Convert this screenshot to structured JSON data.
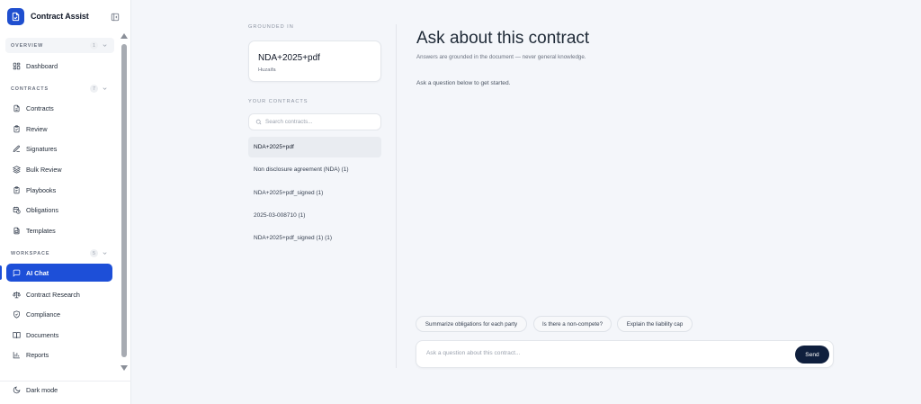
{
  "app": {
    "name": "Contract Assist"
  },
  "sidebar": {
    "sections": [
      {
        "title": "OVERVIEW",
        "count": "1",
        "items": [
          {
            "label": "Dashboard",
            "icon": "dashboard-icon"
          }
        ]
      },
      {
        "title": "CONTRACTS",
        "count": "7",
        "items": [
          {
            "label": "Contracts",
            "icon": "document-icon"
          },
          {
            "label": "Review",
            "icon": "clipboard-check-icon"
          },
          {
            "label": "Signatures",
            "icon": "pen-icon"
          },
          {
            "label": "Bulk Review",
            "icon": "layers-icon"
          },
          {
            "label": "Playbooks",
            "icon": "clipboard-icon"
          },
          {
            "label": "Obligations",
            "icon": "calendar-clock-icon"
          },
          {
            "label": "Templates",
            "icon": "file-template-icon"
          }
        ]
      },
      {
        "title": "WORKSPACE",
        "count": "5",
        "items": [
          {
            "label": "AI Chat",
            "icon": "chat-icon",
            "active": true
          },
          {
            "label": "Contract Research",
            "icon": "scale-icon"
          },
          {
            "label": "Compliance",
            "icon": "shield-check-icon"
          },
          {
            "label": "Documents",
            "icon": "book-icon"
          },
          {
            "label": "Reports",
            "icon": "bar-chart-icon"
          }
        ]
      }
    ],
    "footer": {
      "dark_mode_label": "Dark mode"
    }
  },
  "context": {
    "grounded_label": "GROUNDED IN",
    "current_document": {
      "name": "NDA+2025+pdf",
      "owner": "Huzaifa"
    },
    "contracts_label": "YOUR CONTRACTS",
    "search_placeholder": "Search contracts...",
    "contracts": [
      {
        "name": "NDA+2025+pdf",
        "selected": true
      },
      {
        "name": "Non disclosure agreement (NDA) (1)"
      },
      {
        "name": "NDA+2025+pdf_signed (1)"
      },
      {
        "name": "2025-03-008710 (1)"
      },
      {
        "name": "NDA+2025+pdf_signed (1) (1)"
      }
    ]
  },
  "chat": {
    "title": "Ask about this contract",
    "subtitle": "Answers are grounded in the document — never general knowledge.",
    "empty_state": "Ask a question below to get started.",
    "suggestions": [
      "Summarize obligations for each party",
      "Is there a non-compete?",
      "Explain the liability cap"
    ],
    "input_placeholder": "Ask a question about this contract...",
    "send_label": "Send"
  },
  "colors": {
    "accent": "#1d4fd8",
    "send_button": "#0f1f3d",
    "background": "#f4f6fa"
  }
}
